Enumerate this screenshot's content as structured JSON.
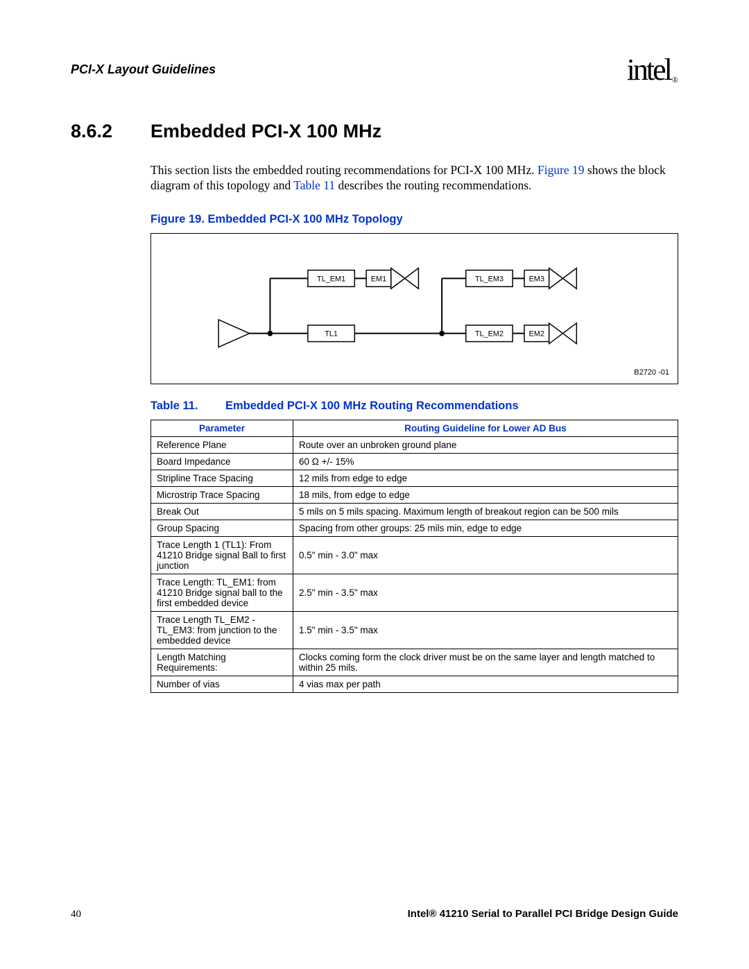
{
  "header": {
    "title": "PCI-X Layout Guidelines",
    "logo_text": "intel",
    "logo_reg": "®"
  },
  "section": {
    "number": "8.6.2",
    "title": "Embedded PCI-X 100 MHz"
  },
  "paragraph": {
    "before_link1": "This section lists the embedded routing recommendations for PCI-X 100 MHz. ",
    "link1": "Figure 19",
    "mid": " shows the block diagram of this topology and ",
    "link2": "Table 11",
    "after": " describes the routing recommendations."
  },
  "figure": {
    "caption": "Figure 19. Embedded PCI-X 100 MHz Topology",
    "corner_label": "B2720 -01",
    "labels": {
      "TL_EM1": "TL_EM1",
      "EM1": "EM1",
      "TL_EM3": "TL_EM3",
      "EM3": "EM3",
      "TL1": "TL1",
      "TL_EM2": "TL_EM2",
      "EM2": "EM2"
    }
  },
  "table": {
    "title_label": "Table 11.",
    "title_text": "Embedded PCI-X 100 MHz Routing Recommendations",
    "headers": {
      "param": "Parameter",
      "guideline": "Routing Guideline for Lower AD Bus"
    },
    "rows": [
      {
        "param": "Reference Plane",
        "value": "Route over an unbroken ground plane"
      },
      {
        "param": "Board Impedance",
        "value": "60 Ω +/- 15%"
      },
      {
        "param": "Stripline Trace Spacing",
        "value": "12 mils from edge to edge"
      },
      {
        "param": "Microstrip Trace Spacing",
        "value": "18 mils, from edge to edge"
      },
      {
        "param": "Break Out",
        "value": "5 mils on 5 mils spacing. Maximum length of breakout region can be 500 mils"
      },
      {
        "param": "Group Spacing",
        "value": "Spacing from other groups: 25 mils min, edge to edge"
      },
      {
        "param": "Trace Length 1 (TL1): From 41210 Bridge signal Ball to first junction",
        "value": "0.5\" min - 3.0\" max"
      },
      {
        "param": "Trace Length: TL_EM1: from 41210 Bridge signal ball to the first embedded device",
        "value": "2.5\" min - 3.5\" max"
      },
      {
        "param": "Trace Length TL_EM2 - TL_EM3: from junction to the embedded device",
        "value": "1.5\" min - 3.5\" max"
      },
      {
        "param": "Length Matching Requirements:",
        "value": "Clocks coming form the clock driver must be on the same layer and length matched to within 25 mils."
      },
      {
        "param": "Number of vias",
        "value": "4 vias max per path"
      }
    ]
  },
  "footer": {
    "page": "40",
    "doc": "Intel® 41210 Serial to Parallel PCI Bridge Design Guide"
  }
}
